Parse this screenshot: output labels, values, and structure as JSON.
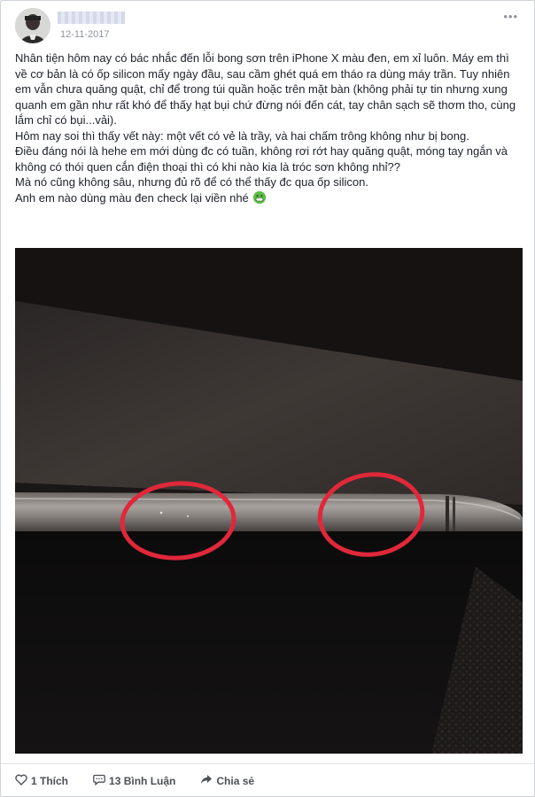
{
  "post": {
    "date": "12-11-2017",
    "menu_icon": "ellipsis-icon",
    "paragraphs": [
      "Nhân tiện hôm nay có bác nhắc đến lỗi bong sơn trên iPhone X màu đen, em xỉ luôn. Máy em thì về cơ bản là có ốp silicon mấy ngày đầu, sau cầm ghét quá em tháo ra dùng máy trần. Tuy nhiên em vẫn chưa quăng quật, chỉ để trong túi quần hoặc trên mặt bàn (không phải tự tin nhưng xung quanh em gần như rất khó để thấy hạt bụi chứ đừng nói đến cát, tay chân sạch sẽ thơm tho, cùng lắm chỉ có bụi...vải).",
      "Hôm nay soi thì thấy vết này: một vết có vẻ là trầy, và hai chấm trông không như bị bong.",
      "Điều đáng nói là hehe em mới dùng đc có tuần, không rơi rớt hay quăng quật, móng tay ngắn và không có thói quen cắn điện thoại thì có khi nào kia là tróc sơn không nhỉ??",
      "Mà nó cũng không sâu, nhưng đủ rõ để có thể thấy đc qua ốp silicon.",
      "Anh em nào dùng màu đen check lại viền nhé"
    ],
    "emoji_icon": "grinning-face-icon"
  },
  "actions": {
    "like": {
      "icon": "heart-icon",
      "label": "1 Thích"
    },
    "comment": {
      "icon": "comment-icon",
      "label": "13 Bình Luận"
    },
    "share": {
      "icon": "share-icon",
      "label": "Chia sẻ"
    }
  },
  "colors": {
    "circle_annotation": "#e0283a",
    "action_text": "#4b4f56",
    "date_text": "#90949c"
  }
}
